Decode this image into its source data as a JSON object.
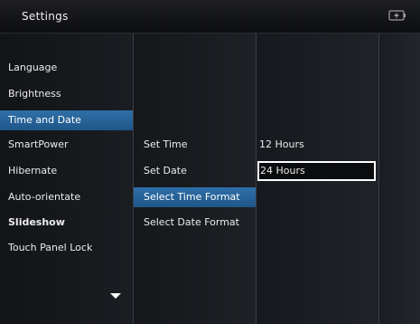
{
  "header": {
    "title": "Settings",
    "status_icon": "battery-charging-icon"
  },
  "menu": {
    "items": [
      {
        "label": "Language"
      },
      {
        "label": "Brightness"
      },
      {
        "label": "Time and Date",
        "selected": true
      },
      {
        "label": "SmartPower"
      },
      {
        "label": "Hibernate"
      },
      {
        "label": "Auto-orientate"
      },
      {
        "label": "Slideshow"
      },
      {
        "label": "Touch Panel Lock"
      }
    ],
    "more_icon": "chevron-down-icon"
  },
  "submenu": {
    "items": [
      {
        "label": "Set Time"
      },
      {
        "label": "Set Date"
      },
      {
        "label": "Select Time Format",
        "selected": true
      },
      {
        "label": "Select Date Format"
      }
    ]
  },
  "options": {
    "items": [
      {
        "label": "12 Hours"
      },
      {
        "label": "24 Hours",
        "focused": true
      }
    ]
  },
  "colors": {
    "selection": "#2a6aa3",
    "background": "#15181c",
    "focus_border": "#ffffff"
  }
}
